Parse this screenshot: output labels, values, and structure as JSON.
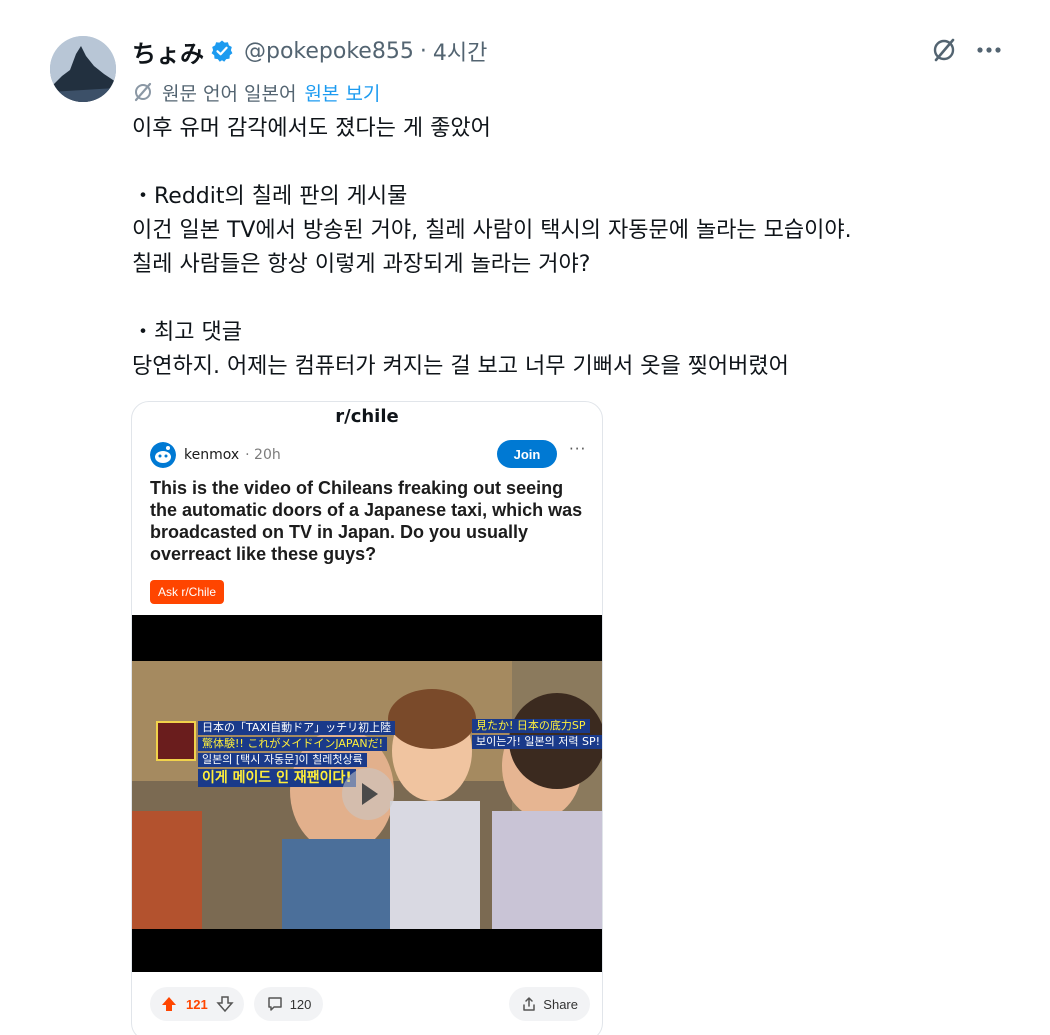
{
  "author": {
    "display_name": "ちょみ",
    "handle": "@pokepoke855",
    "separator": "·",
    "time": "4시간"
  },
  "translation": {
    "label": "원문 언어 일본어",
    "link": "원본 보기"
  },
  "tweet": {
    "lines": [
      "이후 유머 감각에서도 졌다는 게 좋았어",
      "",
      "・Reddit의 칠레 판의 게시물",
      "이건 일본 TV에서 방송된 거야, 칠레 사람이 택시의 자동문에 놀라는 모습이야.",
      "칠레 사람들은 항상 이렇게 과장되게 놀라는 거야?",
      "",
      "・최고 댓글",
      "당연하지. 어제는 컴퓨터가 켜지는 걸 보고 너무 기뻐서 옷을 찢어버렸어"
    ]
  },
  "reddit_card": {
    "subreddit": "r/chile",
    "username": "kenmox",
    "time": "· 20h",
    "join_label": "Join",
    "more_label": "···",
    "title": "This is the video of Chileans freaking out seeing the automatic doors of a Japanese taxi, which was broadcasted on TV in Japan. Do you usually overreact like these guys?",
    "flair": "Ask r/Chile",
    "video_captions": {
      "line1": "日本の「TAXI自動ドア」ッチリ初上陸",
      "line2": "驚体験!! これがメイドインJAPANだ!",
      "line3": "일본의 [택시 자동문]이 칠레첫상륙",
      "line4": "이게 메이드 인 재팬이다!",
      "right1": "見たか! 日本の底力SP",
      "right2": "보이는가! 일본의 저력 SP!"
    },
    "upvotes": "121",
    "comments": "120",
    "share_label": "Share"
  },
  "colors": {
    "accent_blue": "#1d9bf0",
    "reddit_blue": "#0079d3",
    "reddit_orange": "#ff4500",
    "secondary_text": "#536471"
  }
}
